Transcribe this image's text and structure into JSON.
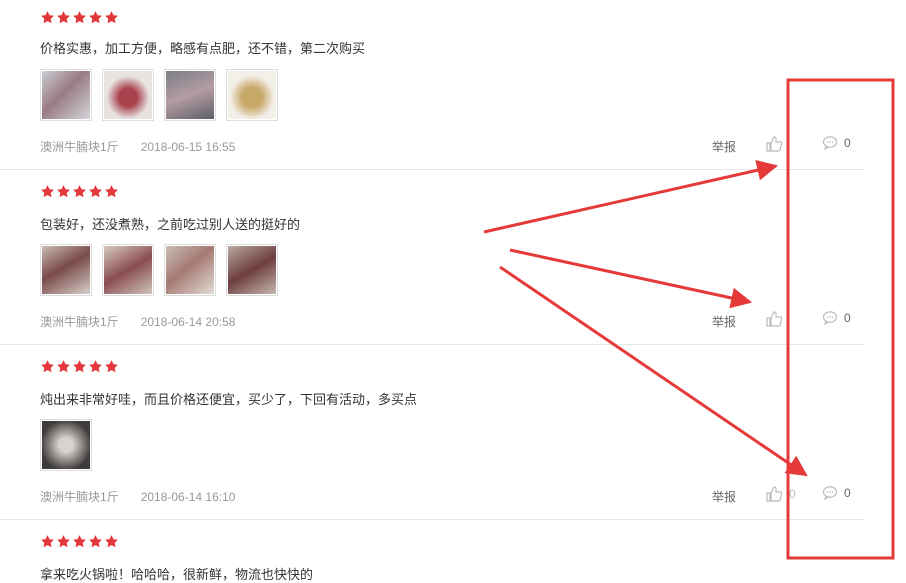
{
  "labels": {
    "report": "举报"
  },
  "reviews": [
    {
      "rating": 5,
      "text": "价格实惠，加工方便，略感有点肥，还不错，第二次购买",
      "product": "澳洲牛腩块1斤",
      "date": "2018-06-15 16:55",
      "like_count": "",
      "comment_count": "0"
    },
    {
      "rating": 5,
      "text": "包装好，还没煮熟，之前吃过别人送的挺好的",
      "product": "澳洲牛腩块1斤",
      "date": "2018-06-14 20:58",
      "like_count": "",
      "comment_count": "0"
    },
    {
      "rating": 5,
      "text": "炖出来非常好哇，而且价格还便宜，买少了，下回有活动，多买点",
      "product": "澳洲牛腩块1斤",
      "date": "2018-06-14 16:10",
      "like_count": "0",
      "comment_count": "0"
    },
    {
      "rating": 5,
      "text": "拿来吃火锅啦！哈哈哈，很新鲜，物流也快快的"
    }
  ],
  "colors": {
    "star": "#e4393c",
    "annotation": "#e63a3a",
    "divider": "#e6e6e6"
  }
}
